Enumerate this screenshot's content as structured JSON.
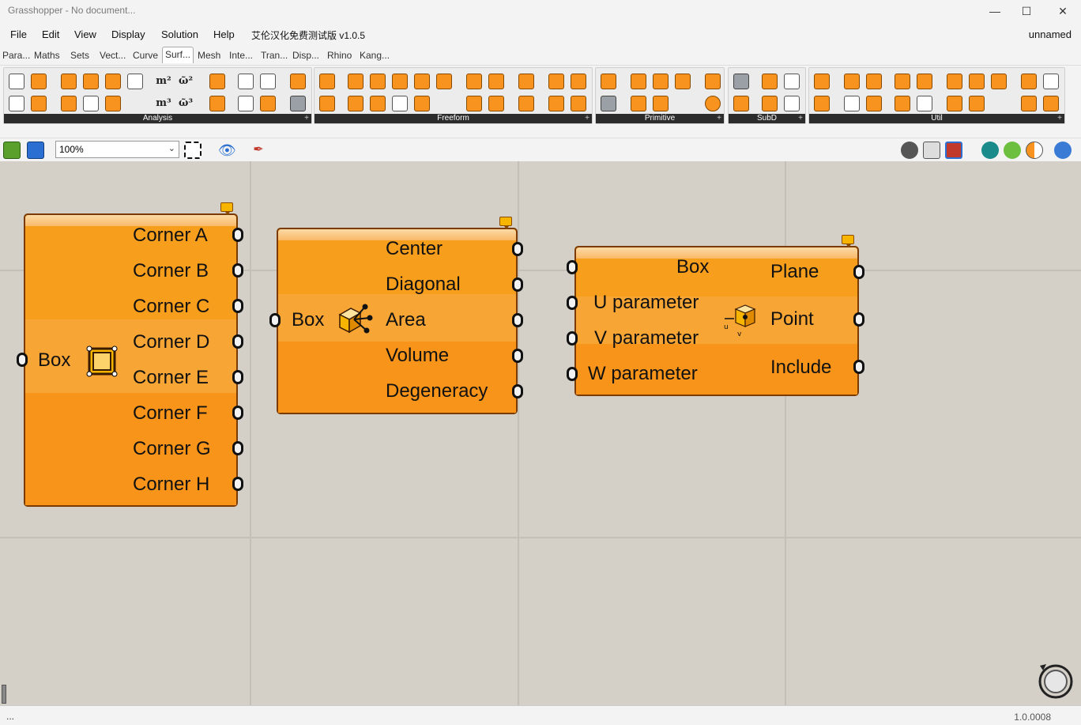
{
  "window": {
    "title": "Grasshopper - No document...",
    "doc_name": "unnamed"
  },
  "menu": [
    "File",
    "Edit",
    "View",
    "Display",
    "Solution",
    "Help",
    "艾伦汉化免费测试版 v1.0.5"
  ],
  "tabs": [
    "Para...",
    "Maths",
    "Sets",
    "Vect...",
    "Curve",
    "Surf...",
    "Mesh",
    "Inte...",
    "Tran...",
    "Disp...",
    "Rhino",
    "Kang..."
  ],
  "active_tab": "Surf...",
  "ribbon_panels": [
    "Analysis",
    "Freeform",
    "Primitive",
    "SubD",
    "Util"
  ],
  "ribbon_text_icons": [
    "m²",
    "ῶ²",
    "m³",
    "ῶ³"
  ],
  "toolbar": {
    "zoom": "100%"
  },
  "components": [
    {
      "name": "box-corners",
      "inputs": [
        "Box"
      ],
      "outputs": [
        "Corner A",
        "Corner B",
        "Corner C",
        "Corner D",
        "Corner E",
        "Corner F",
        "Corner G",
        "Corner H"
      ]
    },
    {
      "name": "box-properties",
      "inputs": [
        "Box"
      ],
      "outputs": [
        "Center",
        "Diagonal",
        "Area",
        "Volume",
        "Degeneracy"
      ]
    },
    {
      "name": "evaluate-box",
      "inputs": [
        "Box",
        "U parameter",
        "V parameter",
        "W parameter"
      ],
      "outputs": [
        "Plane",
        "Point",
        "Include"
      ]
    }
  ],
  "status": {
    "left": "...",
    "right": "1.0.0008"
  },
  "colors": {
    "component": "#f89e1d",
    "component_border": "#7a3a00",
    "canvas": "#d4d0c8"
  }
}
